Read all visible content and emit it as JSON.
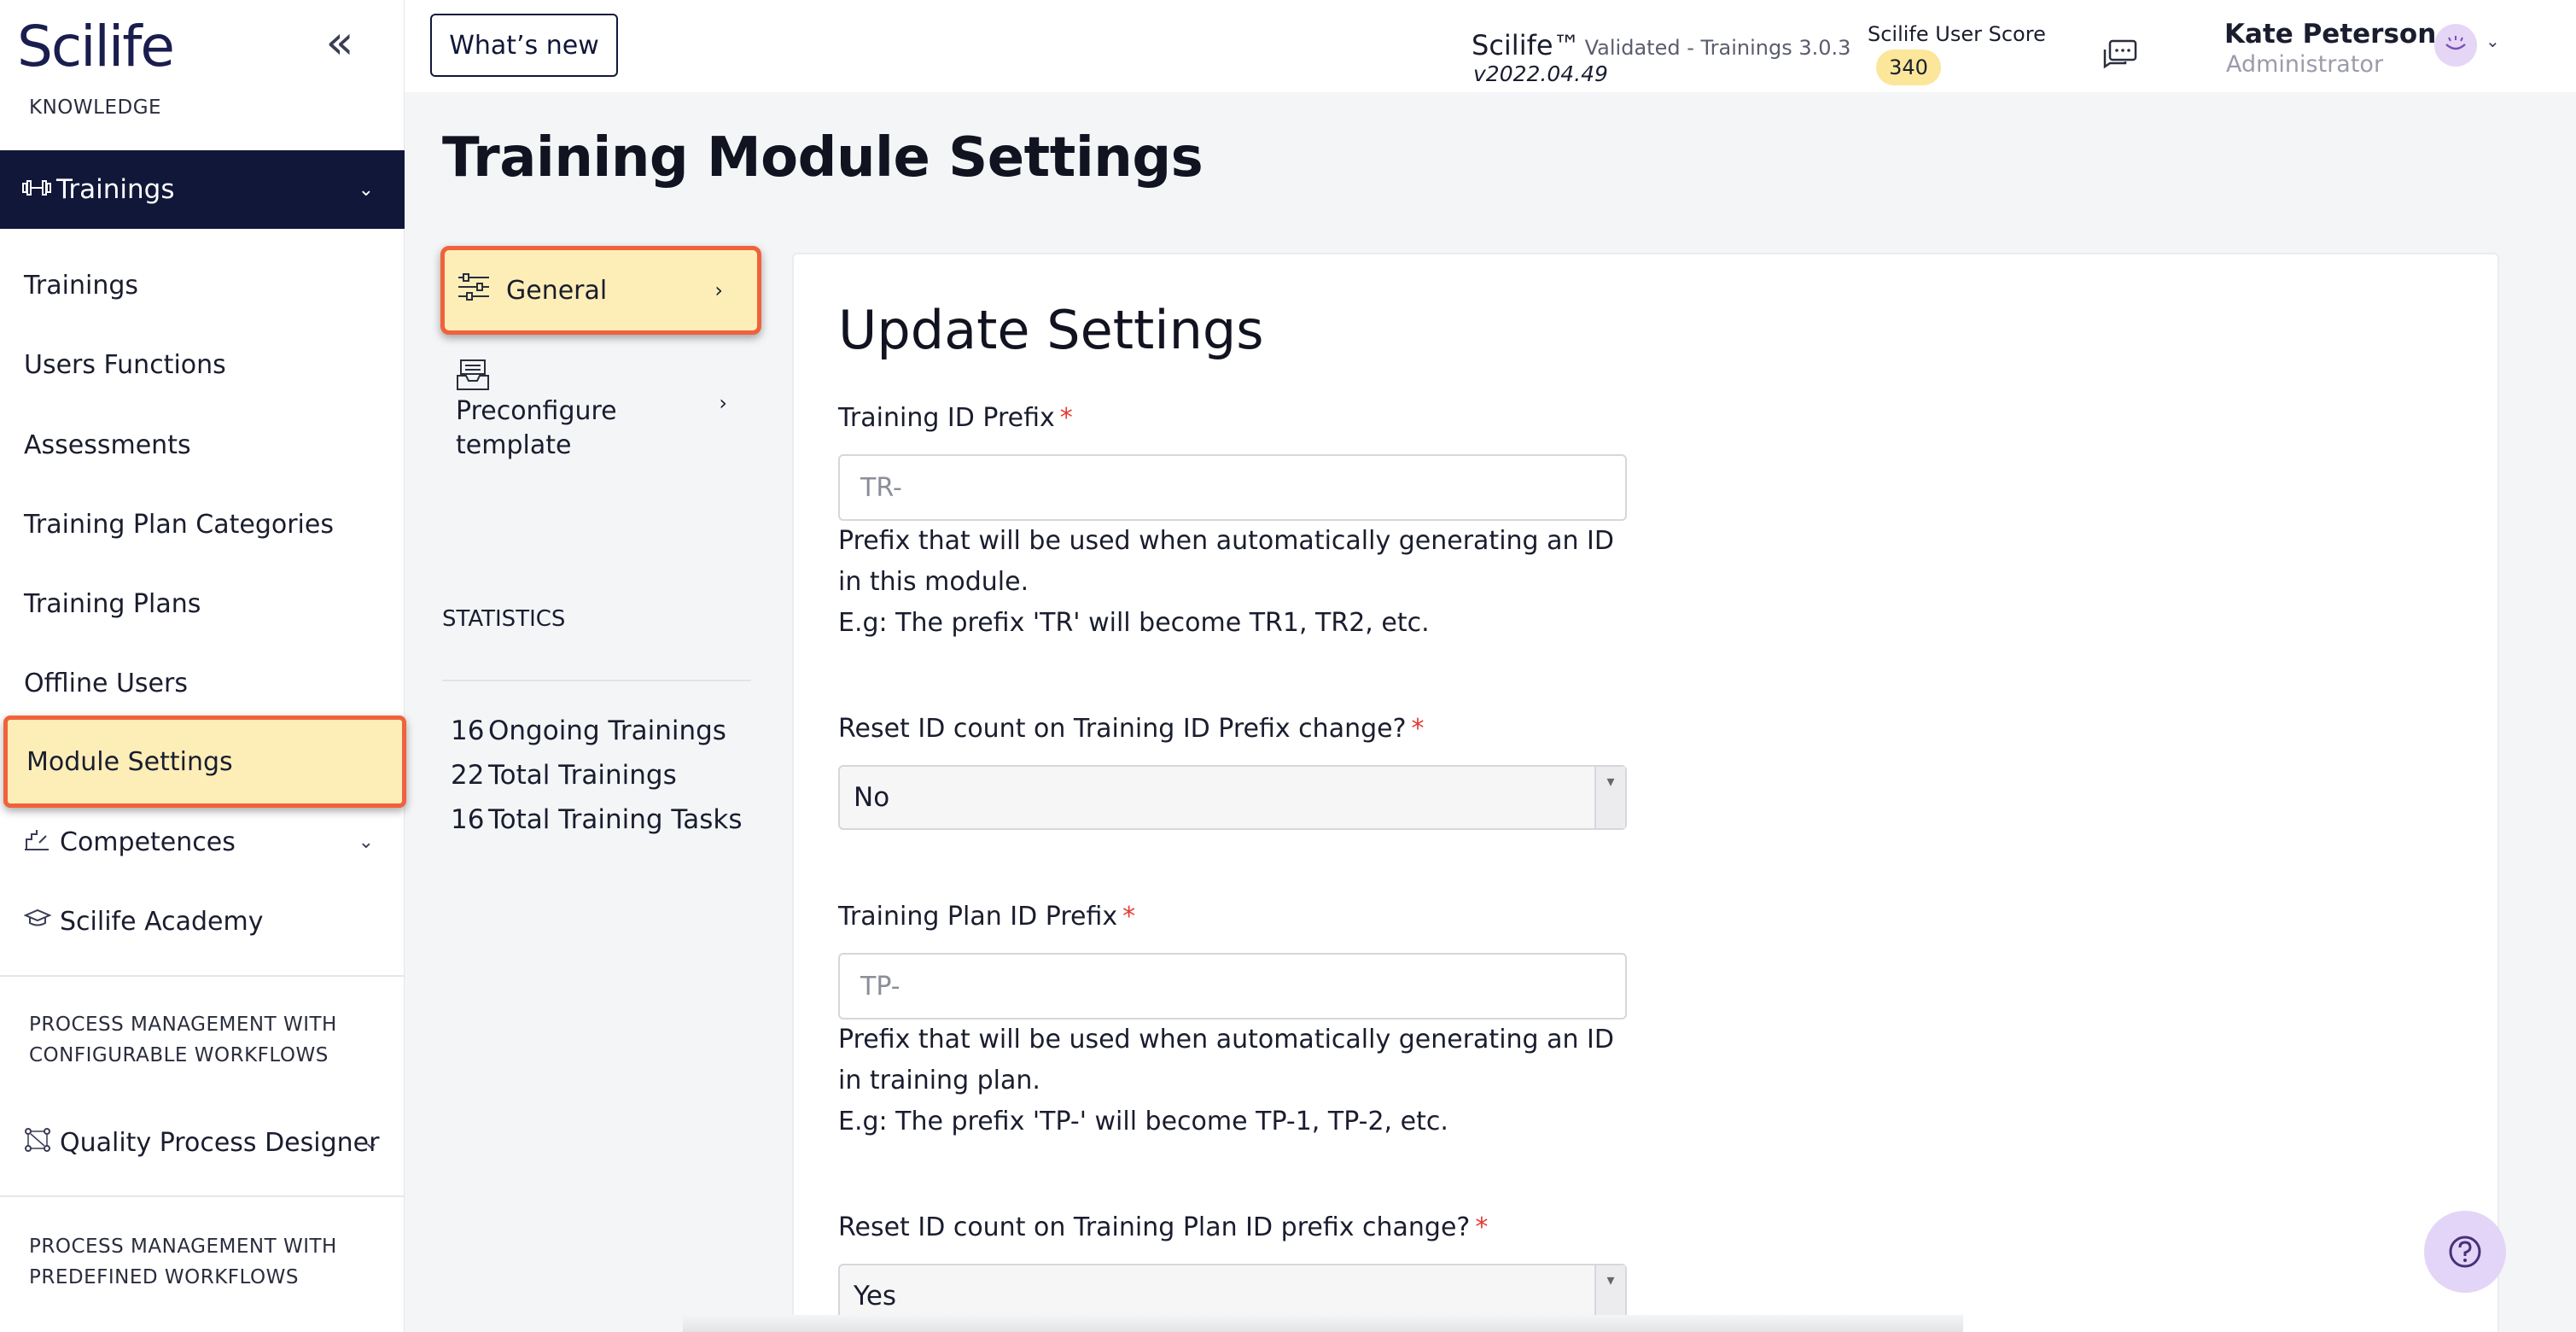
{
  "sidebar": {
    "logo": "Scilife",
    "collapse_icon": "double-chevron-left-icon",
    "section_knowledge": "KNOWLEDGE",
    "active_group": {
      "label": "Trainings",
      "icon": "dumbbell-icon"
    },
    "items": [
      {
        "label": "Trainings"
      },
      {
        "label": "Users Functions"
      },
      {
        "label": "Assessments"
      },
      {
        "label": "Training Plan Categories"
      },
      {
        "label": "Training Plans"
      },
      {
        "label": "Offline Users"
      },
      {
        "label": "Module Settings",
        "highlighted": true
      }
    ],
    "competences": {
      "label": "Competences",
      "icon": "chart-up-icon"
    },
    "academy": {
      "label": "Scilife Academy",
      "icon": "graduation-cap-icon"
    },
    "section_configurable_1": "PROCESS MANAGEMENT WITH",
    "section_configurable_2": "CONFIGURABLE WORKFLOWS",
    "quality_designer": {
      "label": "Quality Process Designer",
      "icon": "workflow-icon"
    },
    "section_predefined_1": "PROCESS MANAGEMENT WITH",
    "section_predefined_2": "PREDEFINED WORKFLOWS"
  },
  "header": {
    "whats_new": "What’s new",
    "brand": "Scilife™",
    "validated": "Validated - Trainings 3.0.3",
    "version": "v2022.04.49",
    "score_label": "Scilife User Score",
    "score_value": "340",
    "user_name": "Kate Peterson",
    "user_role": "Administrator"
  },
  "main": {
    "title": "Training Module Settings",
    "subnav": [
      {
        "label": "General",
        "icon": "sliders-icon",
        "highlighted": true
      },
      {
        "label": "Preconfigure template",
        "icon": "inbox-tray-icon"
      }
    ],
    "statistics": {
      "label": "STATISTICS",
      "items": [
        {
          "value": "16",
          "label": "Ongoing Trainings"
        },
        {
          "value": "22",
          "label": "Total Trainings"
        },
        {
          "value": "16",
          "label": "Total Training Tasks"
        }
      ]
    }
  },
  "panel": {
    "title": "Update Settings",
    "training_id_prefix": {
      "label": "Training ID Prefix",
      "placeholder": "TR-",
      "help_1": "Prefix that will be used when automatically generating an ID in this module.",
      "help_2": "E.g: The prefix 'TR' will become TR1, TR2, etc."
    },
    "reset_training_id": {
      "label": "Reset ID count on Training ID Prefix change?",
      "value": "No"
    },
    "training_plan_id_prefix": {
      "label": "Training Plan ID Prefix",
      "placeholder": "TP-",
      "help_1": "Prefix that will be used when automatically generating an ID in training plan.",
      "help_2": "E.g: The prefix 'TP-' will become TP-1, TP-2, etc."
    },
    "reset_training_plan_id": {
      "label": "Reset ID count on Training Plan ID prefix change?",
      "value": "Yes"
    },
    "required_mark": "*"
  },
  "colors": {
    "sidebar_active": "#111739",
    "highlight_fill": "#fdeeb8",
    "highlight_border": "#f0623c",
    "score_badge": "#fbe69a",
    "required": "#e53935"
  }
}
